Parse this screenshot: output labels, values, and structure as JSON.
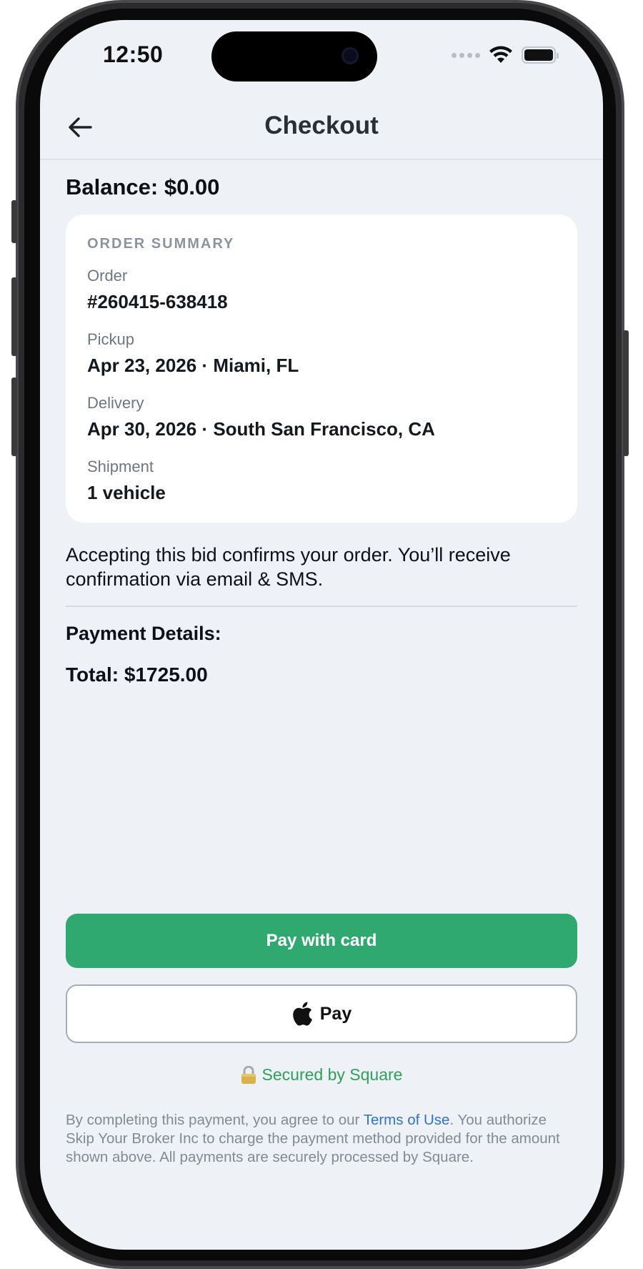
{
  "status_bar": {
    "time": "12:50"
  },
  "header": {
    "title": "Checkout",
    "back_icon": "arrow-left-icon"
  },
  "balance": {
    "label": "Balance: $0.00"
  },
  "order_summary": {
    "heading": "ORDER SUMMARY",
    "fields": [
      {
        "label": "Order",
        "value": "#260415-638418"
      },
      {
        "label": "Pickup",
        "value": "Apr 23, 2026 · Miami, FL"
      },
      {
        "label": "Delivery",
        "value": "Apr 30, 2026 · South San Francisco, CA"
      },
      {
        "label": "Shipment",
        "value": "1 vehicle"
      }
    ]
  },
  "notice": "Accepting this bid confirms your order. You’ll receive confirmation via email & SMS.",
  "payment": {
    "details_label": "Payment Details:",
    "total_label": "Total: $1725.00",
    "pay_card_label": "Pay with card",
    "apple_pay_label": "Pay",
    "apple_icon": "apple-logo-icon",
    "secured_label": "Secured by Square",
    "secured_icon": "lock-icon"
  },
  "legal": {
    "before_link": "By completing this payment, you agree to our ",
    "link_text": "Terms of Use",
    "after_link": ". You authorize Skip Your Broker Inc to charge the payment method provided for the amount shown above. All payments are securely processed by Square."
  },
  "colors": {
    "primary_green": "#2fa96f",
    "secured_green": "#2f9f5b",
    "link_blue": "#2f73c9",
    "screen_bg": "#eef1f6"
  }
}
